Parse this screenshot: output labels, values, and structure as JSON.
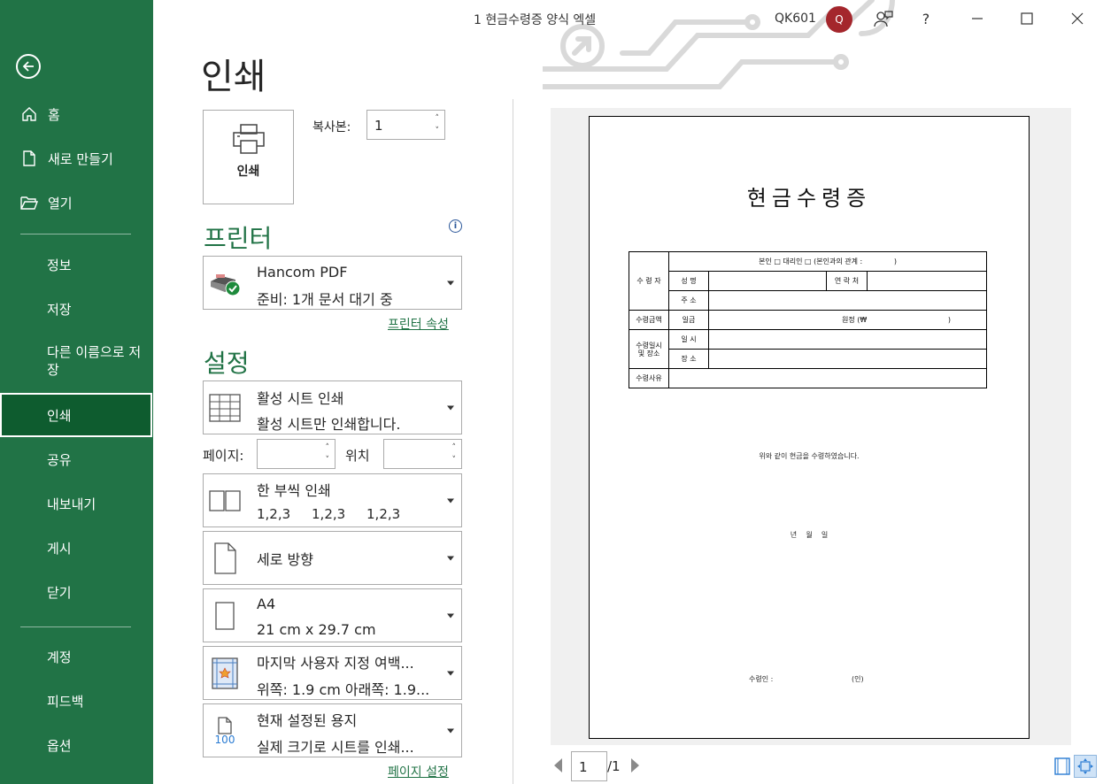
{
  "window": {
    "title": "1 현금수령증 양식 엑셀",
    "user_code": "QK601",
    "avatar_initial": "Q",
    "help_label": "?"
  },
  "sidebar": {
    "items": [
      {
        "label": "홈",
        "icon": "home-icon"
      },
      {
        "label": "새로 만들기",
        "icon": "new-document-icon"
      },
      {
        "label": "열기",
        "icon": "folder-open-icon"
      },
      {
        "label": "정보"
      },
      {
        "label": "저장"
      },
      {
        "label": "다른 이름으로 저장"
      },
      {
        "label": "인쇄",
        "active": true
      },
      {
        "label": "공유"
      },
      {
        "label": "내보내기"
      },
      {
        "label": "게시"
      },
      {
        "label": "닫기"
      },
      {
        "label": "계정"
      },
      {
        "label": "피드백"
      },
      {
        "label": "옵션"
      }
    ]
  },
  "main": {
    "heading": "인쇄",
    "print_button_label": "인쇄",
    "copies_label": "복사본:",
    "copies_value": "1",
    "printer_heading": "프린터",
    "printer_name": "Hancom PDF",
    "printer_status": "준비: 1개 문서 대기 중",
    "printer_properties_link": "프린터 속성",
    "settings_heading": "설정",
    "scope_title": "활성 시트 인쇄",
    "scope_desc": "활성 시트만 인쇄합니다.",
    "pages_label": "페이지:",
    "to_label": "위치",
    "collate_title": "한 부씩 인쇄",
    "collate_desc": "1,2,3     1,2,3     1,2,3",
    "orientation": "세로 방향",
    "paper_size": "A4",
    "paper_dims": "21 cm x 29.7 cm",
    "margins_title": "마지막 사용자 지정 여백...",
    "margins_desc": "위쪽: 1.9 cm 아래쪽: 1.9...",
    "scaling_title": "현재 설정된 용지",
    "scaling_desc": "실제 크기로 시트를 인쇄...",
    "scaling_icon_text": "100",
    "page_setup_link": "페이지 설정"
  },
  "preview": {
    "title": "현금수령증",
    "row1": "본인 □ 대리인 □ (본인과의 관계 :              )",
    "receiver_label": "수 령 자",
    "name_label": "성   명",
    "contact_label": "연 락 처",
    "address_label": "주   소",
    "amount_label": "수령금액",
    "amount_prefix": "일금",
    "amount_suffix": "원정 (₩                                    )",
    "datetime_label": "수령일시 및 장소",
    "date_label": "일   시",
    "place_label": "장   소",
    "reason_label": "수령사유",
    "confirm_text": "위와 같이 현금을 수령하였습니다.",
    "ymd_text": "년    월    일",
    "signer_label": "수령인 :",
    "seal_label": "(인)",
    "current_page": "1",
    "total_pages": "/1"
  },
  "colors": {
    "sidebar": "#217346",
    "sidebar_active": "#0e5c2f",
    "accent": "#217346",
    "avatar": "#a4262c"
  }
}
